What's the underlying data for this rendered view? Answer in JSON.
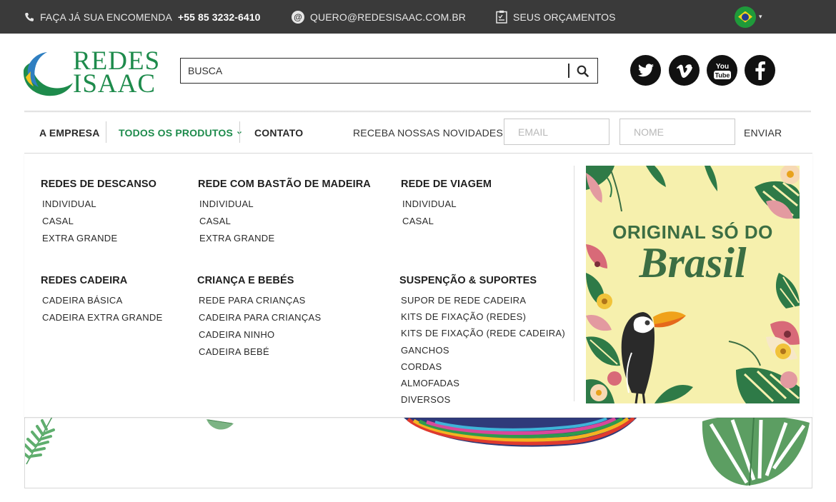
{
  "topbar": {
    "phone_label": "FAÇA JÁ SUA ENCOMENDA",
    "phone_number": "+55 85 3232-6410",
    "email": "QUERO@REDESISAAC.COM.BR",
    "budgets": "SEUS ORÇAMENTOS",
    "at_symbol": "@"
  },
  "logo": {
    "line1": "REDES",
    "line2": "ISAAC"
  },
  "search": {
    "value": "",
    "placeholder": "BUSCA"
  },
  "social": [
    "twitter-icon",
    "vimeo-icon",
    "youtube-icon",
    "facebook-icon"
  ],
  "nav": {
    "empresa": "A EMPRESA",
    "produtos": "TODOS OS PRODUTOS",
    "contato": "CONTATO",
    "newsletter_label": "RECEBA NOSSAS NOVIDADES",
    "email_placeholder": "EMAIL",
    "name_placeholder": "NOME",
    "send": "ENVIAR"
  },
  "menu": {
    "col1": {
      "title": "REDES DE DESCANSO",
      "items": [
        "INDIVIDUAL",
        "CASAL",
        "EXTRA GRANDE"
      ]
    },
    "col2": {
      "title": "REDE COM BASTÃO DE MADEIRA",
      "items": [
        "INDIVIDUAL",
        "CASAL",
        "EXTRA GRANDE"
      ]
    },
    "col3": {
      "title": "REDE DE VIAGEM",
      "items": [
        "INDIVIDUAL",
        "CASAL"
      ]
    },
    "col4": {
      "title": "REDES CADEIRA",
      "items": [
        "CADEIRA BÁSICA",
        "CADEIRA EXTRA GRANDE"
      ]
    },
    "col5": {
      "title": "CRIANÇA E BEBÉS",
      "items": [
        "REDE PARA CRIANÇAS",
        "CADEIRA PARA CRIANÇAS",
        "CADEIRA NINHO",
        "CADEIRA BEBÉ"
      ]
    },
    "col6": {
      "title": "SUSPENÇÃO & SUPORTES",
      "items": [
        "SUPOR DE REDE CADEIRA",
        "KITS DE FIXAÇÃO (REDES)",
        "KITS DE FIXAÇÃO (REDE CADEIRA)",
        "GANCHOS",
        "CORDAS",
        "ALMOFADAS",
        "DIVERSOS"
      ]
    }
  },
  "banner": {
    "line1": "ORIGINAL SÓ DO",
    "line2": "Brasil"
  },
  "colors": {
    "brand_green": "#1e8b4c",
    "topbar": "#3a3a3a",
    "banner_bg": "#f6f0ad",
    "banner_text": "#3c6e43"
  }
}
